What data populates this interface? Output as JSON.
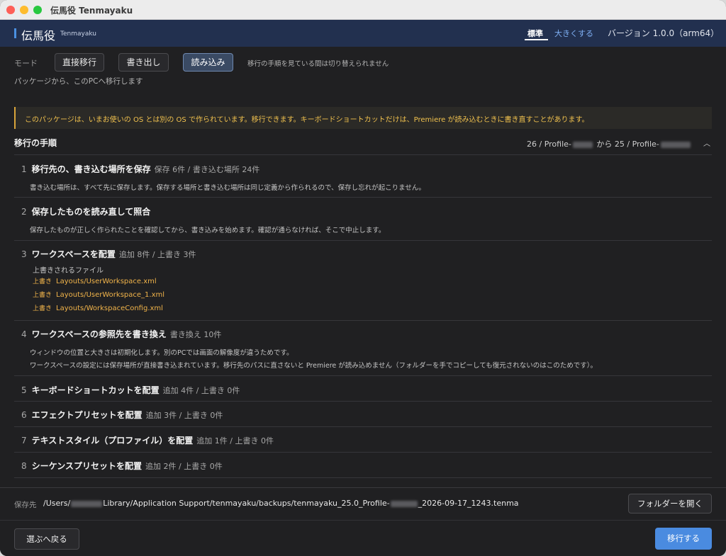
{
  "window": {
    "title": "伝馬役 Tenmayaku"
  },
  "header": {
    "app_name": "伝馬役",
    "app_name_sub": "Tenmayaku",
    "size_standard": "標準",
    "size_large": "大きくする",
    "version": "バージョン 1.0.0（arm64）"
  },
  "mode": {
    "label": "モード",
    "options": [
      "直接移行",
      "書き出し",
      "読み込み"
    ],
    "selected": "読み込み",
    "note": "移行の手順を見ている間は切り替えられません",
    "description": "パッケージから、このPCへ移行します"
  },
  "warning": "このパッケージは、いまお使いの OS とは別の OS で作られています。移行できます。キーボードショートカットだけは、Premiere が読み込むときに書き直すことがあります。",
  "steps": {
    "title": "移行の手順",
    "range_prefix": "26 / Profile-",
    "range_middle": " から 25 / Profile-",
    "items": [
      {
        "num": "1",
        "title": "移行先の、書き込む場所を保存",
        "count": "保存 6件 / 書き込む場所 24件",
        "details": [
          "書き込む場所は、すべて先に保存します。保存する場所と書き込む場所は同じ定義から作られるので、保存し忘れが起こりません。"
        ]
      },
      {
        "num": "2",
        "title": "保存したものを読み直して照合",
        "count": "",
        "details": [
          "保存したものが正しく作られたことを確認してから、書き込みを始めます。確認が通らなければ、そこで中止します。"
        ]
      },
      {
        "num": "3",
        "title": "ワークスペースを配置",
        "count": "追加 8件 / 上書き 3件",
        "files_label": "上書きされるファイル",
        "files": [
          {
            "tag": "上書き",
            "path": "Layouts/UserWorkspace.xml"
          },
          {
            "tag": "上書き",
            "path": "Layouts/UserWorkspace_1.xml"
          },
          {
            "tag": "上書き",
            "path": "Layouts/WorkspaceConfig.xml"
          }
        ]
      },
      {
        "num": "4",
        "title": "ワークスペースの参照先を書き換え",
        "count": "書き換え 10件",
        "details": [
          "ウィンドウの位置と大きさは初期化します。別のPCでは画面の解像度が違うためです。",
          "ワークスペースの設定には保存場所が直接書き込まれています。移行先のパスに直さないと Premiere が読み込めません（フォルダーを手でコピーしても復元されないのはこのためです）。"
        ]
      },
      {
        "num": "5",
        "title": "キーボードショートカットを配置",
        "count": "追加 4件 / 上書き 0件"
      },
      {
        "num": "6",
        "title": "エフェクトプリセットを配置",
        "count": "追加 3件 / 上書き 0件"
      },
      {
        "num": "7",
        "title": "テキストスタイル（プロファイル）を配置",
        "count": "追加 1件 / 上書き 0件"
      },
      {
        "num": "8",
        "title": "シーケンスプリセットを配置",
        "count": "追加 2件 / 上書き 0件"
      }
    ]
  },
  "footer": {
    "save_label": "保存先",
    "save_path_prefix": "/Users/",
    "save_path_middle": "Library/Application Support/tenmayaku/backups/tenmayaku_25.0_Profile-",
    "save_path_suffix": "_2026-09-17_1243.tenma",
    "open_folder": "フォルダーを開く",
    "back": "選ぶへ戻る",
    "migrate": "移行する"
  }
}
